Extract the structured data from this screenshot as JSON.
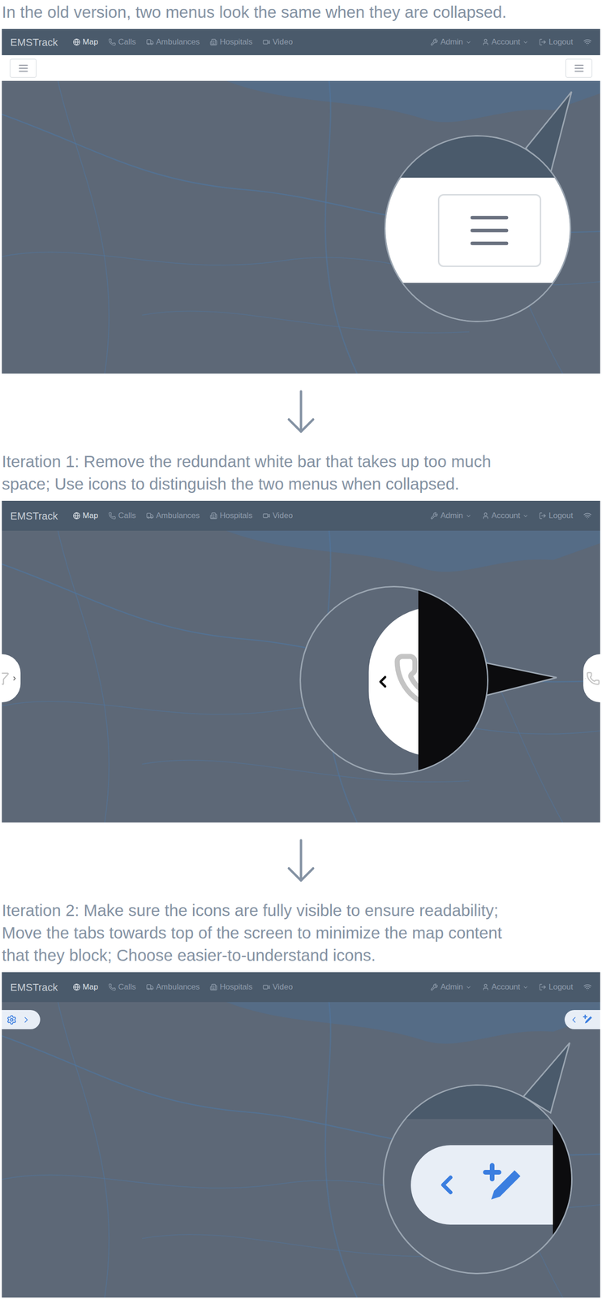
{
  "navbar": {
    "brand": "EMSTrack",
    "items": [
      {
        "label": "Map",
        "selected": true
      },
      {
        "label": "Calls",
        "selected": false
      },
      {
        "label": "Ambulances",
        "selected": false
      },
      {
        "label": "Hospitals",
        "selected": false
      },
      {
        "label": "Video",
        "selected": false
      }
    ],
    "right_items": [
      {
        "label": "Admin",
        "dropdown": true
      },
      {
        "label": "Account",
        "dropdown": true
      },
      {
        "label": "Logout",
        "dropdown": false
      }
    ]
  },
  "panels": [
    {
      "kind": "hamburger",
      "caption": [
        "In the old version, two menus look the same when they are collapsed."
      ]
    },
    {
      "kind": "side-tabs",
      "caption": [
        "Iteration 1: Remove the redundant white bar that takes up too much",
        "space; Use icons to distinguish the two menus when collapsed."
      ]
    },
    {
      "kind": "top-tabs",
      "caption": [
        "Iteration 2: Make sure the icons are fully visible to ensure readability;",
        "Move the tabs towards top of the screen to minimize the map content",
        "that they block; Choose easier-to-understand icons."
      ]
    }
  ]
}
